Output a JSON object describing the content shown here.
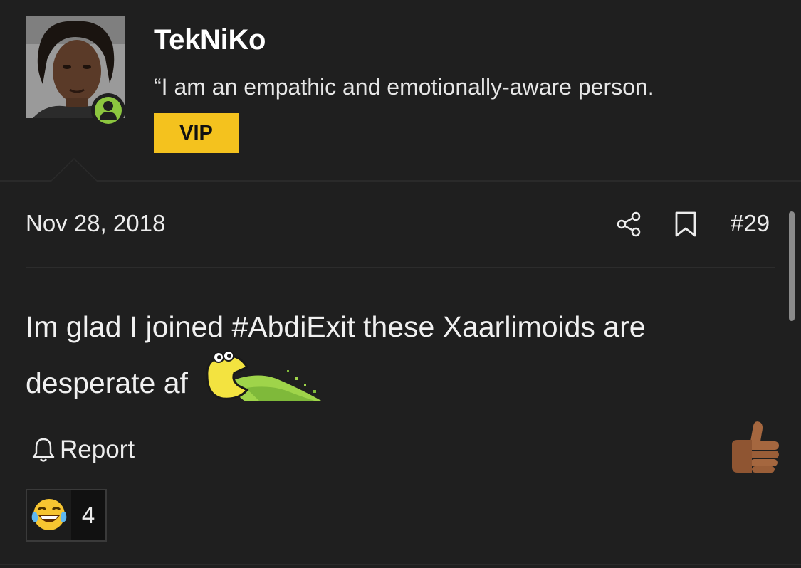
{
  "user": {
    "name": "TekNiKo",
    "title": "“I am an empathic and emotionally-aware person.",
    "badge": "VIP",
    "status": "online"
  },
  "post": {
    "date": "Nov 28, 2018",
    "number": "#29",
    "body_text": "Im glad I joined #AbdiExit these Xaarlimoids are desperate af",
    "inline_emoji": "puke-emoji"
  },
  "actions": {
    "report_label": "Report",
    "like_icon": "thumbs-up-icon",
    "share_icon": "share-icon",
    "bookmark_icon": "bookmark-icon"
  },
  "reactions": {
    "emoji": "laughing-tears-emoji",
    "count": "4"
  },
  "colors": {
    "background": "#1f1f1f",
    "vip": "#f4c21e",
    "online": "#8cc63f"
  }
}
